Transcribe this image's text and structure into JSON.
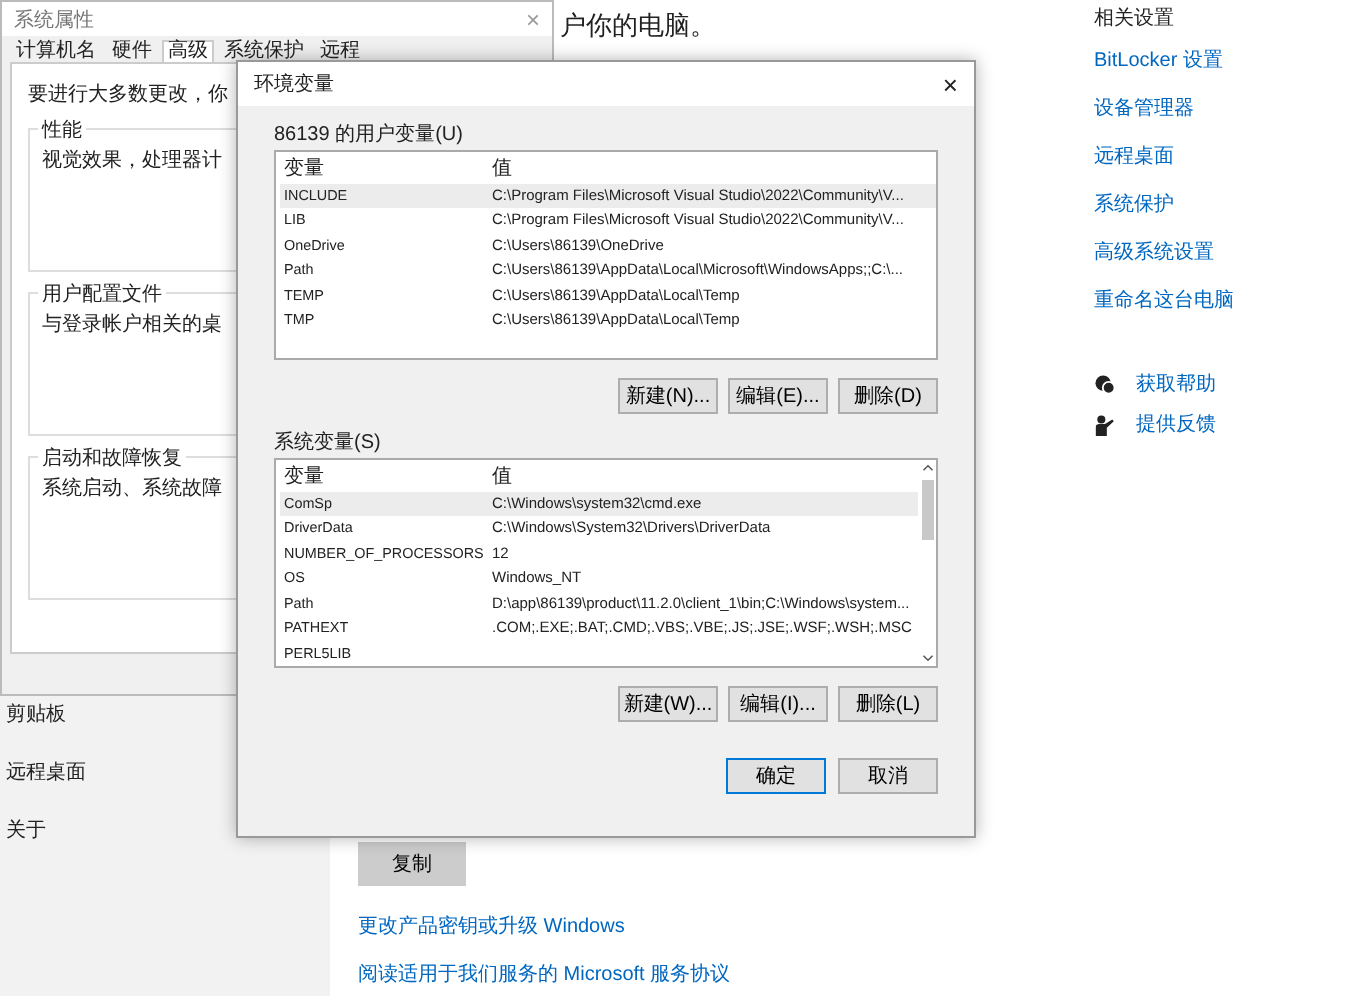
{
  "settings_page": {
    "nav_items": [
      {
        "label": "剪贴板",
        "selected": false
      },
      {
        "label": "远程桌面",
        "selected": false
      },
      {
        "label": "关于",
        "selected": false
      }
    ],
    "heading": "户你的电脑。",
    "copy_button": "复制",
    "links": [
      "更改产品密钥或升级 Windows",
      "阅读适用于我们服务的 Microsoft 服务协议"
    ],
    "related": {
      "title": "相关设置",
      "links": [
        "BitLocker 设置",
        "设备管理器",
        "远程桌面",
        "系统保护",
        "高级系统设置",
        "重命名这台电脑"
      ]
    },
    "help_links": [
      {
        "kind": "help",
        "label": "获取帮助"
      },
      {
        "kind": "feedback",
        "label": "提供反馈"
      }
    ]
  },
  "system_properties": {
    "title": "系统属性",
    "close": "×",
    "tabs": [
      {
        "label": "计算机名",
        "selected": false
      },
      {
        "label": "硬件",
        "selected": false
      },
      {
        "label": "高级",
        "selected": true
      },
      {
        "label": "系统保护",
        "selected": false
      },
      {
        "label": "远程",
        "selected": false
      }
    ],
    "intro": "要进行大多数更改，你",
    "groups": [
      {
        "title": "性能",
        "text": "视觉效果，处理器计"
      },
      {
        "title": "用户配置文件",
        "text": "与登录帐户相关的桌"
      },
      {
        "title": "启动和故障恢复",
        "text": "系统启动、系统故障"
      }
    ]
  },
  "environment_variables": {
    "title": "环境变量",
    "close": "×",
    "user_vars": {
      "title": "86139 的用户变量(U)",
      "columns": [
        "变量",
        "值"
      ],
      "rows": [
        {
          "name": "INCLUDE",
          "value": "C:\\Program Files\\Microsoft Visual Studio\\2022\\Community\\V...",
          "selected": true
        },
        {
          "name": "LIB",
          "value": "C:\\Program Files\\Microsoft Visual Studio\\2022\\Community\\V...",
          "selected": false
        },
        {
          "name": "OneDrive",
          "value": "C:\\Users\\86139\\OneDrive",
          "selected": false
        },
        {
          "name": "Path",
          "value": "C:\\Users\\86139\\AppData\\Local\\Microsoft\\WindowsApps;;C:\\...",
          "selected": false
        },
        {
          "name": "TEMP",
          "value": "C:\\Users\\86139\\AppData\\Local\\Temp",
          "selected": false
        },
        {
          "name": "TMP",
          "value": "C:\\Users\\86139\\AppData\\Local\\Temp",
          "selected": false
        }
      ],
      "buttons": [
        "新建(N)...",
        "编辑(E)...",
        "删除(D)"
      ]
    },
    "system_vars": {
      "title": "系统变量(S)",
      "columns": [
        "变量",
        "值"
      ],
      "rows": [
        {
          "name": "ComSp",
          "value": "C:\\Windows\\system32\\cmd.exe",
          "selected": true
        },
        {
          "name": "DriverData",
          "value": "C:\\Windows\\System32\\Drivers\\DriverData",
          "selected": false
        },
        {
          "name": "NUMBER_OF_PROCESSORS",
          "value": "12",
          "selected": false
        },
        {
          "name": "OS",
          "value": "Windows_NT",
          "selected": false
        },
        {
          "name": "Path",
          "value": "D:\\app\\86139\\product\\11.2.0\\client_1\\bin;C:\\Windows\\system...",
          "selected": false
        },
        {
          "name": "PATHEXT",
          "value": ".COM;.EXE;.BAT;.CMD;.VBS;.VBE;.JS;.JSE;.WSF;.WSH;.MSC",
          "selected": false
        },
        {
          "name": "PERL5LIB",
          "value": "",
          "selected": false
        }
      ],
      "buttons": [
        "新建(W)...",
        "编辑(I)...",
        "删除(L)"
      ]
    },
    "ok": "确定",
    "cancel": "取消"
  }
}
